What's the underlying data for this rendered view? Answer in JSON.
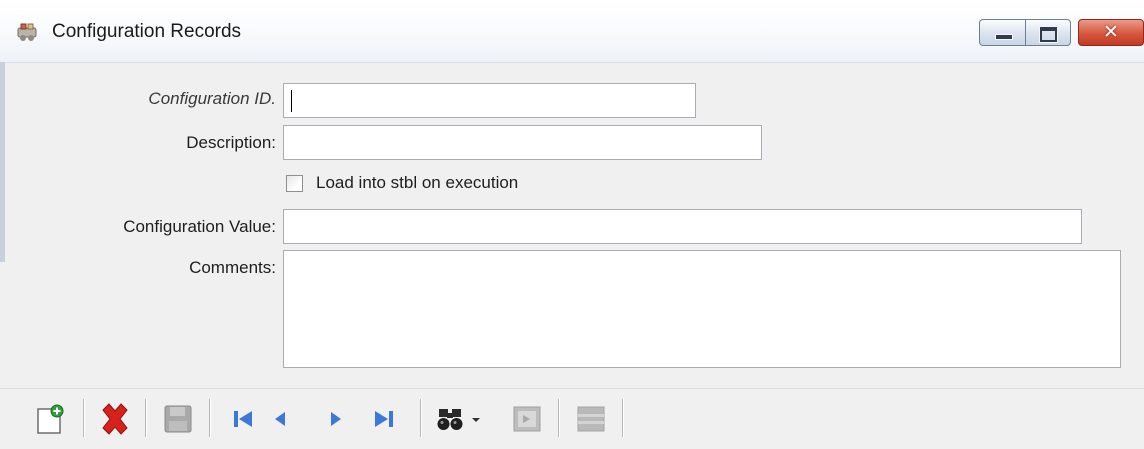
{
  "window": {
    "title": "Configuration Records",
    "icons": {
      "app": "app-icon",
      "minimize": "minimize-icon",
      "maximize": "maximize-icon",
      "close": "close-icon"
    }
  },
  "form": {
    "config_id": {
      "label": "Configuration ID.",
      "value": ""
    },
    "description": {
      "label": "Description:",
      "value": ""
    },
    "load_stbl": {
      "label": "Load into stbl on execution",
      "checked": false
    },
    "config_value": {
      "label": "Configuration Value:",
      "value": ""
    },
    "comments": {
      "label": "Comments:",
      "value": ""
    }
  },
  "toolbar": {
    "items": [
      "new-record-icon",
      "delete-icon",
      "save-icon",
      "first-record-icon",
      "previous-record-icon",
      "next-record-icon",
      "last-record-icon",
      "find-icon",
      "find-dropdown-icon",
      "lookup-icon",
      "grid-view-icon"
    ],
    "colors": {
      "delete": "#d8211b",
      "nav": "#3d78d8",
      "disabled": "#a9a9a9"
    }
  }
}
